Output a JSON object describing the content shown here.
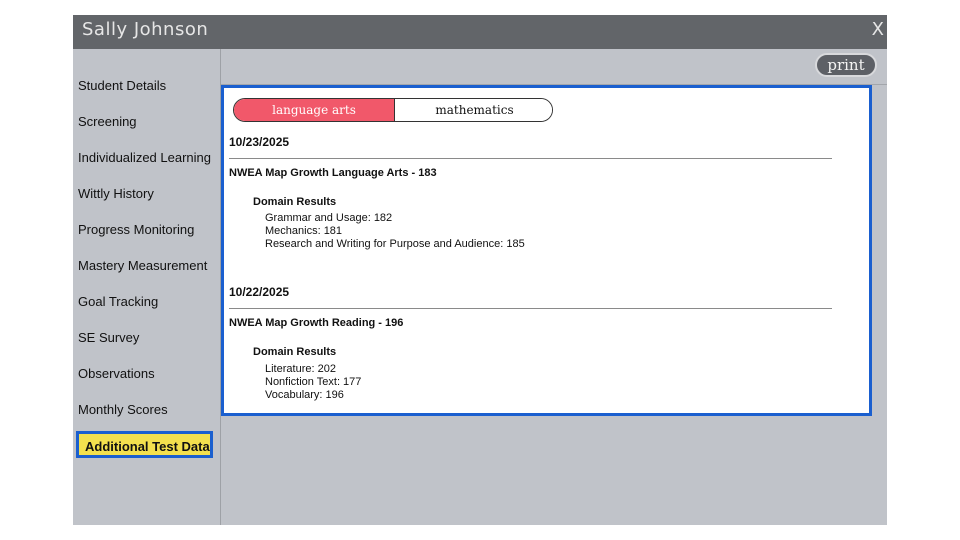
{
  "window": {
    "title": "Sally Johnson",
    "close_label": "X"
  },
  "sidebar": {
    "items": [
      {
        "label": "Student Details"
      },
      {
        "label": "Screening"
      },
      {
        "label": "Individualized Learning"
      },
      {
        "label": "Wittly History"
      },
      {
        "label": "Progress Monitoring"
      },
      {
        "label": "Mastery Measurement"
      },
      {
        "label": "Goal Tracking"
      },
      {
        "label": "SE Survey"
      },
      {
        "label": "Observations"
      },
      {
        "label": "Monthly Scores"
      },
      {
        "label": "Additional Test Data",
        "active": true
      }
    ]
  },
  "toolbar": {
    "print_label": "print"
  },
  "tabs": [
    {
      "label": "language arts",
      "active": true
    },
    {
      "label": "mathematics",
      "active": false
    }
  ],
  "results": [
    {
      "date": "10/23/2025",
      "test": "NWEA Map Growth Language Arts - 183",
      "domain_heading": "Domain Results",
      "domains": [
        "Grammar and Usage: 182",
        "Mechanics: 181",
        "Research and Writing for Purpose and Audience: 185"
      ]
    },
    {
      "date": "10/22/2025",
      "test": "NWEA Map Growth Reading - 196",
      "domain_heading": "Domain Results",
      "domains": [
        "Literature: 202",
        "Nonfiction Text: 177",
        "Vocabulary: 196"
      ]
    }
  ],
  "colors": {
    "titlebar": "#626569",
    "window_bg": "#c0c3c9",
    "active_tab": "#f1586a",
    "highlight_border": "#1a5fcf",
    "active_nav_bg": "#f3e04e"
  }
}
